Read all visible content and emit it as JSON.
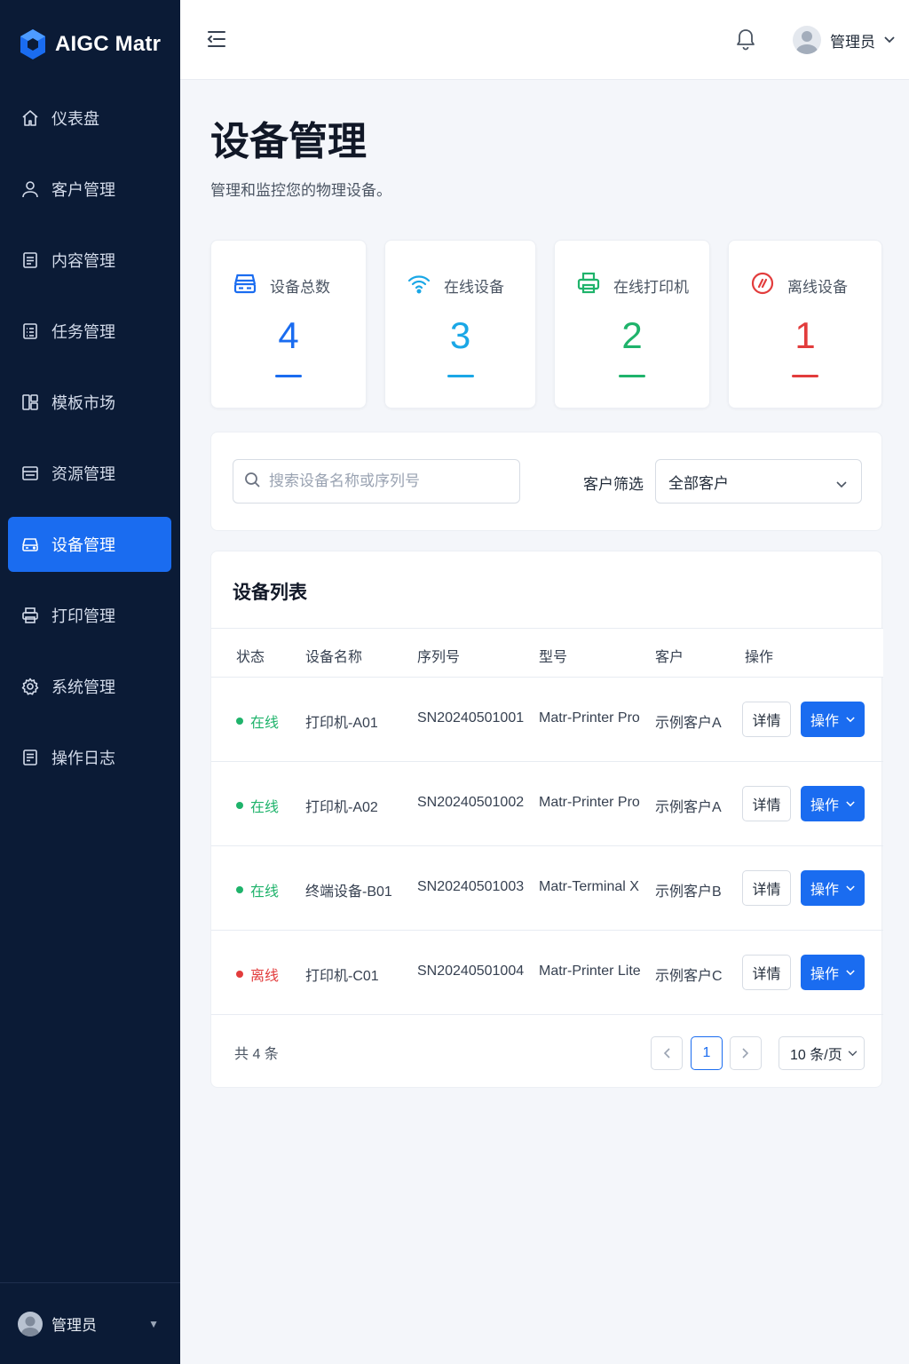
{
  "brand": {
    "name": "AIGC Matr"
  },
  "sidebar": {
    "items": [
      {
        "label": "仪表盘",
        "icon": "home-icon"
      },
      {
        "label": "客户管理",
        "icon": "user-icon"
      },
      {
        "label": "内容管理",
        "icon": "document-icon"
      },
      {
        "label": "任务管理",
        "icon": "task-icon"
      },
      {
        "label": "模板市场",
        "icon": "template-icon"
      },
      {
        "label": "资源管理",
        "icon": "folder-icon"
      },
      {
        "label": "设备管理",
        "icon": "device-icon",
        "active": true
      },
      {
        "label": "打印管理",
        "icon": "printer-icon"
      },
      {
        "label": "系统管理",
        "icon": "gear-icon"
      },
      {
        "label": "操作日志",
        "icon": "log-icon"
      }
    ],
    "footer_user": "管理员"
  },
  "topbar": {
    "user_name": "管理员"
  },
  "page": {
    "title": "设备管理",
    "subtitle": "管理和监控您的物理设备。"
  },
  "stats": [
    {
      "label": "设备总数",
      "value": "4",
      "color": "#1a6cf0",
      "icon": "server-icon"
    },
    {
      "label": "在线设备",
      "value": "3",
      "color": "#1aa7e6",
      "icon": "wifi-icon"
    },
    {
      "label": "在线打印机",
      "value": "2",
      "color": "#1fb36b",
      "icon": "printer-icon"
    },
    {
      "label": "离线设备",
      "value": "1",
      "color": "#e23c3c",
      "icon": "offline-icon"
    }
  ],
  "filter": {
    "search_placeholder": "搜索设备名称或序列号",
    "customer_label": "客户筛选",
    "customer_value": "全部客户"
  },
  "table": {
    "title": "设备列表",
    "columns": [
      "状态",
      "设备名称",
      "序列号",
      "型号",
      "客户",
      "操作"
    ],
    "rows": [
      {
        "status": "在线",
        "status_color": "#1fb36b",
        "name": "打印机-A01",
        "serial": "SN20240501001",
        "model": "Matr-Printer Pro",
        "customer": "示例客户A"
      },
      {
        "status": "在线",
        "status_color": "#1fb36b",
        "name": "打印机-A02",
        "serial": "SN20240501002",
        "model": "Matr-Printer Pro",
        "customer": "示例客户A"
      },
      {
        "status": "在线",
        "status_color": "#1fb36b",
        "name": "终端设备-B01",
        "serial": "SN20240501003",
        "model": "Matr-Terminal X",
        "customer": "示例客户B"
      },
      {
        "status": "离线",
        "status_color": "#e23c3c",
        "name": "打印机-C01",
        "serial": "SN20240501004",
        "model": "Matr-Printer Lite",
        "customer": "示例客户C"
      }
    ],
    "detail_label": "详情",
    "action_label": "操作",
    "total": "共 4 条",
    "current_page": "1",
    "page_size": "10 条/页"
  },
  "colors": {
    "accent": "#1a6cf0",
    "sidebar_bg": "#0b1b36"
  }
}
